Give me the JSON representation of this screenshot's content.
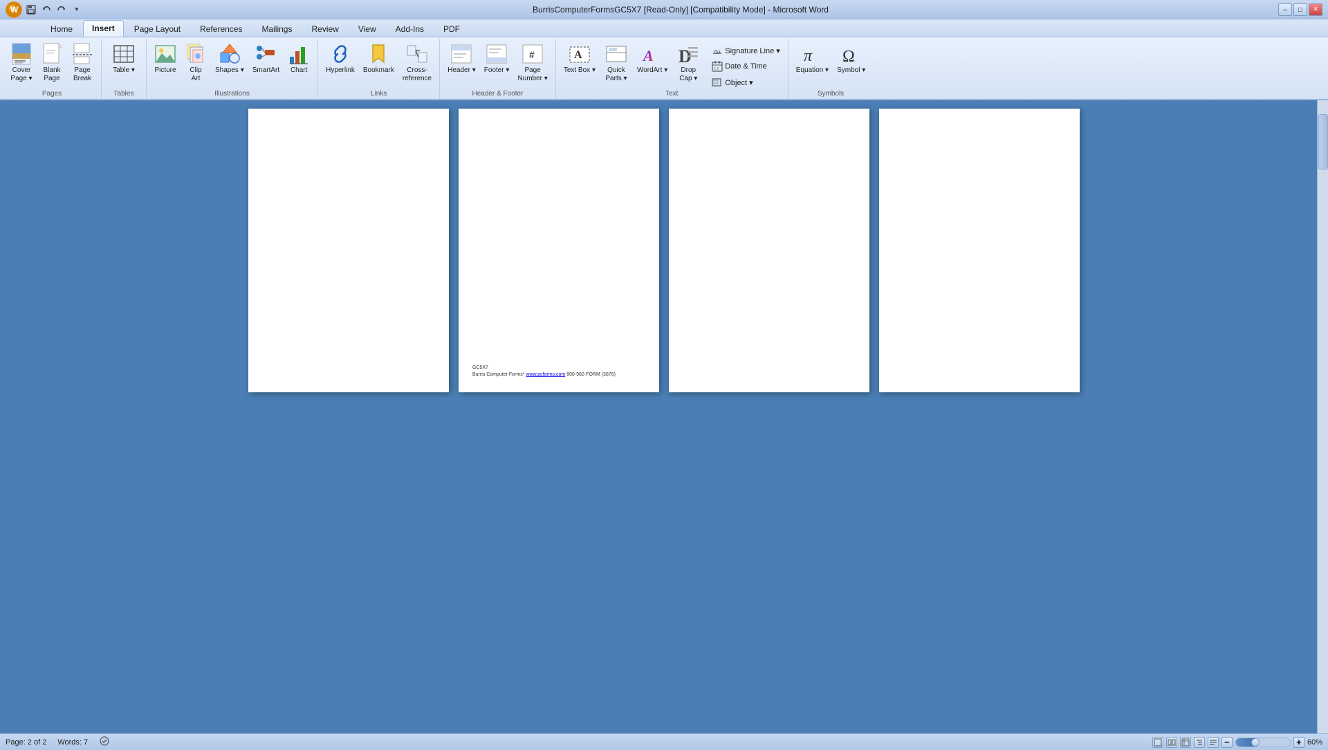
{
  "titlebar": {
    "title": "BurrisComputerFormsGC5X7 [Read-Only] [Compatibility Mode] - Microsoft Word",
    "logo": "W",
    "min_btn": "─",
    "max_btn": "□",
    "close_btn": "✕"
  },
  "quickaccess": {
    "save": "💾",
    "undo": "↩",
    "redo": "↪"
  },
  "tabs": [
    {
      "id": "home",
      "label": "Home",
      "active": false
    },
    {
      "id": "insert",
      "label": "Insert",
      "active": true
    },
    {
      "id": "pagelayout",
      "label": "Page Layout",
      "active": false
    },
    {
      "id": "references",
      "label": "References",
      "active": false
    },
    {
      "id": "mailings",
      "label": "Mailings",
      "active": false
    },
    {
      "id": "review",
      "label": "Review",
      "active": false
    },
    {
      "id": "view",
      "label": "View",
      "active": false
    },
    {
      "id": "addins",
      "label": "Add-Ins",
      "active": false
    },
    {
      "id": "pdf",
      "label": "PDF",
      "active": false
    }
  ],
  "ribbon": {
    "groups": [
      {
        "id": "pages",
        "label": "Pages",
        "buttons": [
          {
            "id": "cover-page",
            "label": "Cover\nPage",
            "icon": "📄",
            "has_dropdown": true
          },
          {
            "id": "blank-page",
            "label": "Blank\nPage",
            "icon": "📃"
          },
          {
            "id": "page-break",
            "label": "Page\nBreak",
            "icon": "📑"
          }
        ]
      },
      {
        "id": "tables",
        "label": "Tables",
        "buttons": [
          {
            "id": "table",
            "label": "Table",
            "icon": "⊞",
            "has_dropdown": true,
            "large": true
          }
        ]
      },
      {
        "id": "illustrations",
        "label": "Illustrations",
        "buttons": [
          {
            "id": "picture",
            "label": "Picture",
            "icon": "🖼"
          },
          {
            "id": "clip-art",
            "label": "Clip\nArt",
            "icon": "✂"
          },
          {
            "id": "shapes",
            "label": "Shapes",
            "icon": "◇",
            "has_dropdown": true
          },
          {
            "id": "smartart",
            "label": "SmartArt",
            "icon": "🔷"
          },
          {
            "id": "chart",
            "label": "Chart",
            "icon": "📊"
          }
        ]
      },
      {
        "id": "links",
        "label": "Links",
        "buttons": [
          {
            "id": "hyperlink",
            "label": "Hyperlink",
            "icon": "🔗"
          },
          {
            "id": "bookmark",
            "label": "Bookmark",
            "icon": "🔖"
          },
          {
            "id": "cross-reference",
            "label": "Cross-\nreference",
            "icon": "↔"
          }
        ]
      },
      {
        "id": "header-footer",
        "label": "Header & Footer",
        "buttons": [
          {
            "id": "header",
            "label": "Header",
            "icon": "▣",
            "has_dropdown": true
          },
          {
            "id": "footer",
            "label": "Footer",
            "icon": "▢",
            "has_dropdown": true
          },
          {
            "id": "page-number",
            "label": "Page\nNumber",
            "icon": "#",
            "has_dropdown": true
          }
        ]
      },
      {
        "id": "text",
        "label": "Text",
        "buttons": [
          {
            "id": "text-box",
            "label": "Text Box",
            "icon": "A",
            "has_dropdown": true,
            "large": true
          },
          {
            "id": "quick-parts",
            "label": "Quick\nParts",
            "icon": "⊟",
            "has_dropdown": true
          },
          {
            "id": "wordart",
            "label": "WordArt",
            "icon": "A",
            "style": "italic bold",
            "has_dropdown": true
          },
          {
            "id": "drop-cap",
            "label": "Drop\nCap",
            "icon": "D",
            "has_dropdown": true
          },
          {
            "id": "signature-line",
            "label": "Signature Line",
            "icon": "✍",
            "small": true,
            "has_dropdown": true
          },
          {
            "id": "date-time",
            "label": "Date & Time",
            "icon": "📅",
            "small": true
          },
          {
            "id": "object",
            "label": "Object",
            "icon": "◻",
            "small": true,
            "has_dropdown": true
          }
        ]
      },
      {
        "id": "symbols",
        "label": "Symbols",
        "buttons": [
          {
            "id": "equation",
            "label": "Equation",
            "icon": "π",
            "has_dropdown": true
          },
          {
            "id": "symbol",
            "label": "Symbol",
            "icon": "Ω",
            "has_dropdown": true
          }
        ]
      }
    ]
  },
  "document": {
    "pages": [
      {
        "id": "page1",
        "has_footer": false
      },
      {
        "id": "page2",
        "has_footer": true,
        "footer_line1": "GC5X7",
        "footer_line2": "Burris Computer Forms* www.pcforms.com 800-982-FORM (3876)"
      },
      {
        "id": "page3",
        "has_footer": false
      },
      {
        "id": "page4",
        "has_footer": false
      }
    ]
  },
  "statusbar": {
    "page_info": "Page: 2 of 2",
    "words": "Words: 7",
    "zoom": "60%",
    "zoom_minus": "−",
    "zoom_plus": "+"
  }
}
